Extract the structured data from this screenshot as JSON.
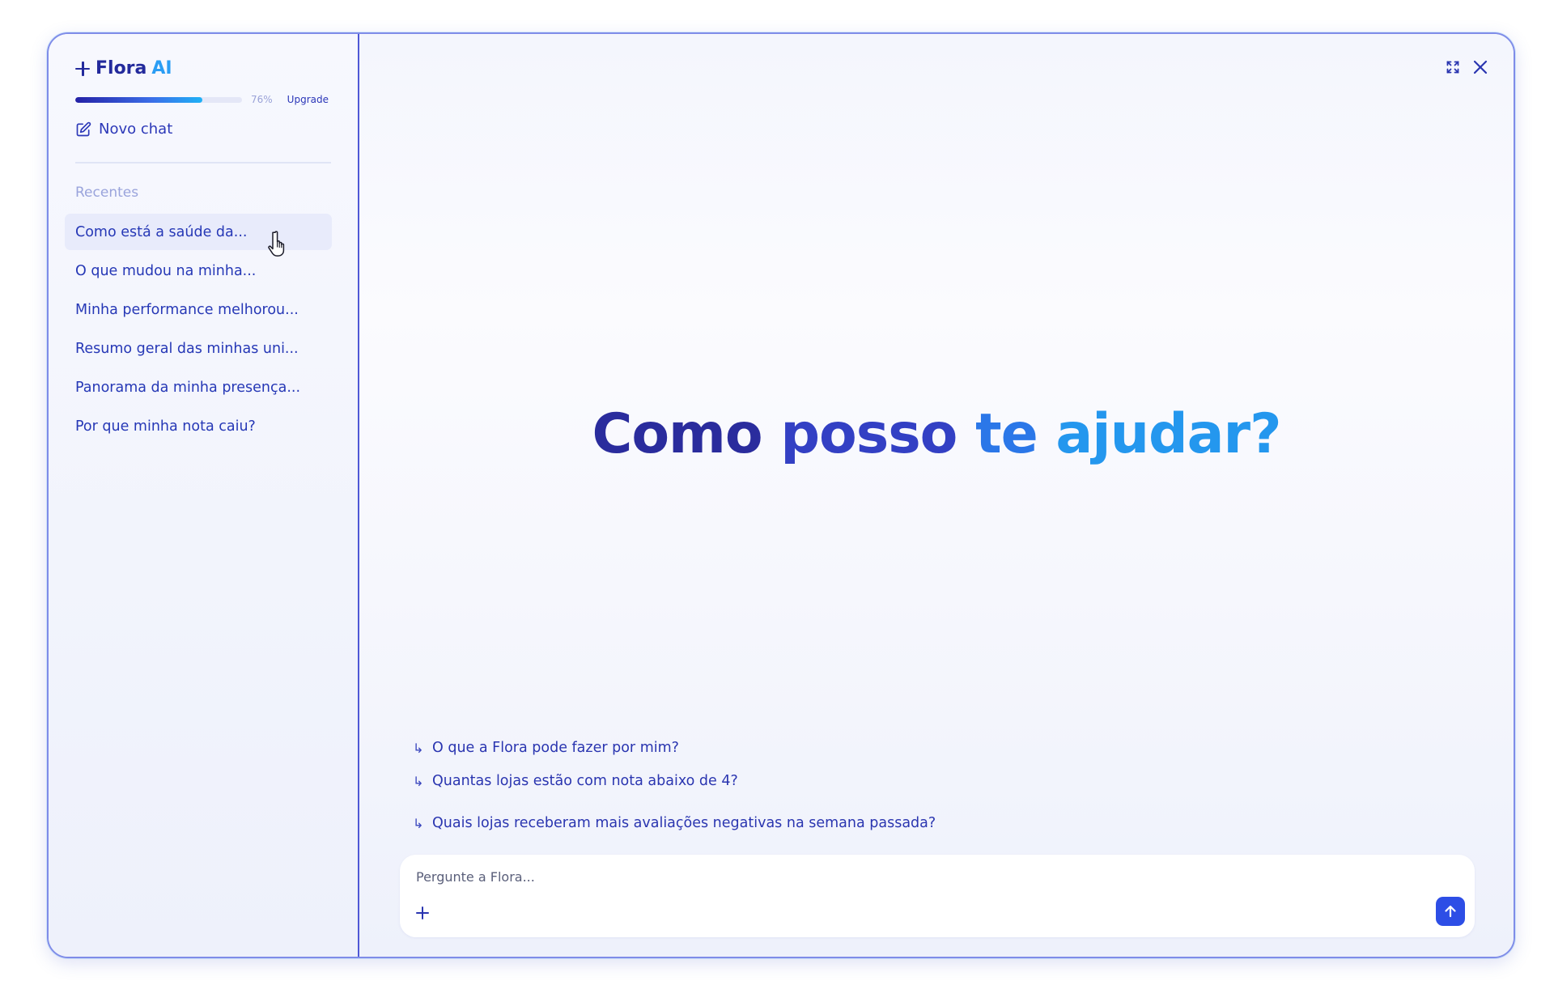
{
  "brand": {
    "name": "Flora",
    "suffix": "AI"
  },
  "usage": {
    "percent_value": 0.76,
    "percent_label": "76%",
    "upgrade_label": "Upgrade"
  },
  "sidebar": {
    "new_chat_label": "Novo chat",
    "recent_title": "Recentes",
    "items": [
      {
        "label": "Como está a saúde da..."
      },
      {
        "label": "O que mudou na minha..."
      },
      {
        "label": "Minha performance melhorou..."
      },
      {
        "label": "Resumo geral das minhas uni..."
      },
      {
        "label": "Panorama da minha presença..."
      },
      {
        "label": "Por que minha nota caiu?"
      }
    ]
  },
  "main": {
    "heading": {
      "w1": "Como",
      "w2": "posso",
      "w3": "te",
      "w4": "ajudar?"
    },
    "suggestions": [
      {
        "label": "O que a Flora pode fazer por mim?"
      },
      {
        "label": "Quantas lojas estão com nota abaixo de 4?"
      },
      {
        "label": "Quais lojas receberam mais avaliações negativas na semana passada?"
      }
    ],
    "composer": {
      "placeholder": "Pergunte a Flora...",
      "value": ""
    }
  },
  "icons": {
    "brand": "sparkle-plus-icon",
    "new_chat": "edit-icon",
    "expand": "expand-icon",
    "close": "close-icon",
    "suggestion": "return-arrow-icon",
    "attach": "plus-icon",
    "send": "arrow-up-icon",
    "cursor": "hand-pointer-icon"
  },
  "colors": {
    "accent": "#2d4ee6",
    "brand_dark": "#232a9c",
    "brand_light": "#2a9df4",
    "text_link": "#2638b6",
    "muted": "#9aa4dc"
  }
}
